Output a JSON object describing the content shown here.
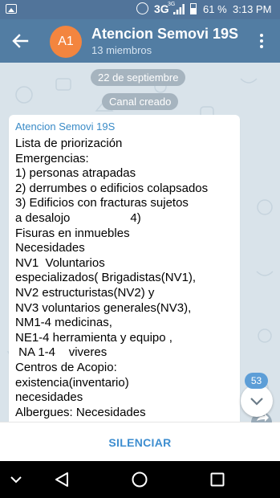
{
  "statusbar": {
    "network": "3G",
    "network_small": "3G",
    "battery": "61 %",
    "time": "3:13 PM"
  },
  "header": {
    "avatar_initials": "A1",
    "title": "Atencion Semovi 19S",
    "subtitle": "13 miembros",
    "avatar_color": "#f3853f",
    "bar_color": "#527da3"
  },
  "chat": {
    "date_pill": "22 de septiembre",
    "service_pill": "Canal creado",
    "message": {
      "sender": "Atencion Semovi 19S",
      "lines": [
        "Lista de priorización",
        "Emergencias:",
        "1) personas atrapadas",
        "2) derrumbes o edificios colapsados",
        "3) Edificios con fracturas sujetos",
        "a desalojo                  4)",
        "Fisuras en inmuebles",
        "Necesidades",
        "NV1  Voluntarios",
        "especializados( Brigadistas(NV1),",
        "NV2 estructuristas(NV2) y",
        "NV3 voluntarios generales(NV3),",
        "NM1-4 medicinas,",
        "NE1-4 herramienta y equipo ,",
        " NA 1-4    viveres",
        "Centros de Acopio:",
        "existencia(inventario)",
        "necesidades",
        "Albergues: Necesidades"
      ]
    },
    "unread_count": "53"
  },
  "bottom": {
    "mute_label": "SILENCIAR"
  },
  "icons": {
    "back": "arrow-left-icon",
    "more": "more-vertical-icon",
    "scroll": "chevron-down-icon",
    "share": "share-icon",
    "nav_back": "triangle-back-icon",
    "nav_home": "circle-home-icon",
    "nav_recent": "square-recents-icon"
  }
}
